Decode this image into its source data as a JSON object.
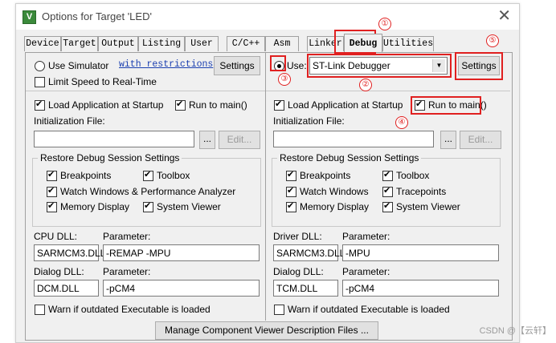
{
  "window": {
    "title": "Options for Target 'LED'",
    "close_glyph": "✕",
    "icon_letter": "V"
  },
  "tabs": [
    "Device",
    "Target",
    "Output",
    "Listing",
    "User",
    "C/C++",
    "Asm",
    "Linker",
    "Debug",
    "Utilities"
  ],
  "active_tab": "Debug",
  "left": {
    "use_simulator_label": "Use Simulator",
    "with_restrictions_link": "with restrictions",
    "settings_label": "Settings",
    "limit_speed_label": "Limit Speed to Real-Time",
    "load_app_label": "Load Application at Startup",
    "run_to_main_label": "Run to main()",
    "init_file_label": "Initialization File:",
    "browse_label": "...",
    "edit_label": "Edit...",
    "restore_title": "Restore Debug Session Settings",
    "breakpoints_label": "Breakpoints",
    "toolbox_label": "Toolbox",
    "watch_label": "Watch Windows & Performance Analyzer",
    "memory_label": "Memory Display",
    "system_viewer_label": "System Viewer",
    "cpu_dll_label": "CPU DLL:",
    "cpu_param_label": "Parameter:",
    "cpu_dll_value": "SARMCM3.DLL",
    "cpu_param_value": "-REMAP -MPU",
    "dialog_dll_label": "Dialog DLL:",
    "dialog_param_label": "Parameter:",
    "dialog_dll_value": "DCM.DLL",
    "dialog_param_value": "-pCM4",
    "warn_label": "Warn if outdated Executable is loaded"
  },
  "right": {
    "use_label": "Use:",
    "debugger_value": "ST-Link Debugger",
    "settings_label": "Settings",
    "load_app_label": "Load Application at Startup",
    "run_to_main_label": "Run to main()",
    "init_file_label": "Initialization File:",
    "browse_label": "...",
    "edit_label": "Edit...",
    "restore_title": "Restore Debug Session Settings",
    "breakpoints_label": "Breakpoints",
    "toolbox_label": "Toolbox",
    "watch_label": "Watch Windows",
    "tracepoints_label": "Tracepoints",
    "memory_label": "Memory Display",
    "system_viewer_label": "System Viewer",
    "driver_dll_label": "Driver DLL:",
    "driver_param_label": "Parameter:",
    "driver_dll_value": "SARMCM3.DLL",
    "driver_param_value": "-MPU",
    "dialog_dll_label": "Dialog DLL:",
    "dialog_param_label": "Parameter:",
    "dialog_dll_value": "TCM.DLL",
    "dialog_param_value": "-pCM4",
    "warn_label": "Warn if outdated Executable is loaded"
  },
  "manage_button_label": "Manage Component Viewer Description Files ...",
  "annotations": [
    "①",
    "②",
    "③",
    "④",
    "⑤"
  ],
  "watermark": "CSDN @【云轩】",
  "colors": {
    "annotation_red": "#e02020",
    "link_blue": "#1a3fb0"
  }
}
